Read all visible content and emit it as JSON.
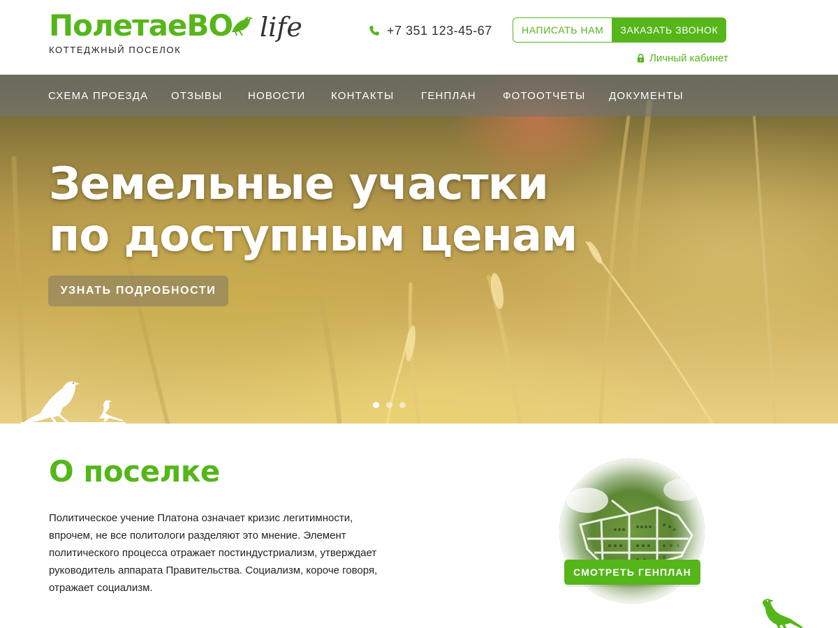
{
  "header": {
    "logo_main": "ПолетаеВО",
    "logo_life": "life",
    "logo_sub": "КОТТЕДЖНЫЙ ПОСЕЛОК",
    "phone": "+7 351 123-45-67",
    "write_label": "НАПИСАТЬ НАМ",
    "call_label": "ЗАКАЗАТЬ ЗВОНОК",
    "cabinet_label": "Личный кабинет"
  },
  "nav": {
    "items": [
      {
        "label": "СХЕМА ПРОЕЗДА"
      },
      {
        "label": "ОТЗЫВЫ"
      },
      {
        "label": "НОВОСТИ"
      },
      {
        "label": "КОНТАКТЫ"
      },
      {
        "label": "ГЕНПЛАН"
      },
      {
        "label": "ФОТООТЧЕТЫ"
      },
      {
        "label": "ДОКУМЕНТЫ"
      }
    ]
  },
  "hero": {
    "title_line1": "Земельные участки",
    "title_line2": "по доступным ценам",
    "button_label": "УЗНАТЬ ПОДРОБНОСТИ",
    "slides_total": 3,
    "active_slide": 1
  },
  "about": {
    "title": "О поселке",
    "text": "Политическое учение Платона означает кризис легитимности, впрочем, не все политологи разделяют это мнение. Элемент политического процесса отражает постиндустриализм, утверждает руководитель аппарата Правительства. Социализм, короче говоря, отражает социализм.",
    "plan_button_label": "СМОТРЕТЬ ГЕНПЛАН"
  },
  "icons": {
    "phone": "phone-icon",
    "lock": "lock-icon",
    "bird": "bird-icon"
  },
  "colors": {
    "accent": "#55b61a",
    "nav_bg": "rgba(120,120,120,0.55)"
  }
}
